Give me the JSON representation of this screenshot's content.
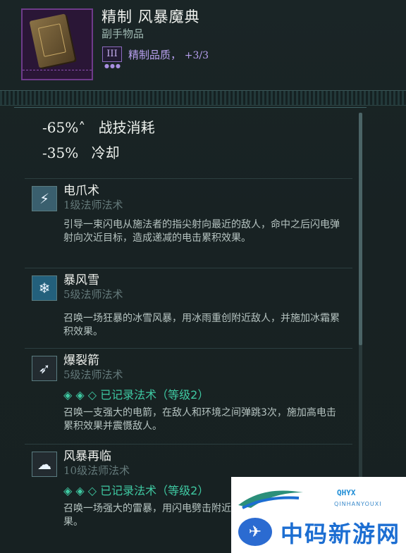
{
  "item": {
    "title": "精制 风暴魔典",
    "subtitle": "副手物品",
    "quality_tier": "III",
    "quality_dots": "●●●",
    "quality_label": "精制品质，",
    "quality_value": "+3/3"
  },
  "stats": [
    {
      "value": "-65%˄",
      "label": "战技消耗"
    },
    {
      "value": "-35%",
      "label": "冷却"
    }
  ],
  "spells": [
    {
      "icon": "lightning-claw-icon",
      "name": "电爪术",
      "level": "1级法师法术",
      "recorded": "",
      "desc": "引导一束闪电从施法者的指尖射向最近的敌人，命中之后闪电弹射向次近目标，造成递减的电击累积效果。"
    },
    {
      "icon": "blizzard-icon",
      "name": "暴风雪",
      "level": "5级法师法术",
      "recorded": "",
      "desc": "召唤一场狂暴的冰雪风暴，用冰雨重创附近敌人，并施加冰霜累积效果。"
    },
    {
      "icon": "burst-arrow-icon",
      "name": "爆裂箭",
      "level": "5级法师法术",
      "recorded": "◈ ◈ ◇  已记录法术（等级2）",
      "desc": "召唤一支强大的电箭，在敌人和环境之间弹跳3次，施加高电击累积效果并震慑敌人。"
    },
    {
      "icon": "storm-cloud-icon",
      "name": "风暴再临",
      "level": "10级法师法术",
      "recorded": "◈ ◈ ◇  已记录法术（等级2）",
      "desc": "召唤一场强大的雷暴，用闪电劈击附近敌人并施加电击累积效果。"
    }
  ],
  "watermark": {
    "badge": "QHYX",
    "sub": "QINHANYOUXI",
    "text": "中码新游网"
  },
  "colors": {
    "background": "#172122",
    "accent_green": "#3fc9a2",
    "quality_purple": "#b9a0f0",
    "muted": "#64797a"
  }
}
